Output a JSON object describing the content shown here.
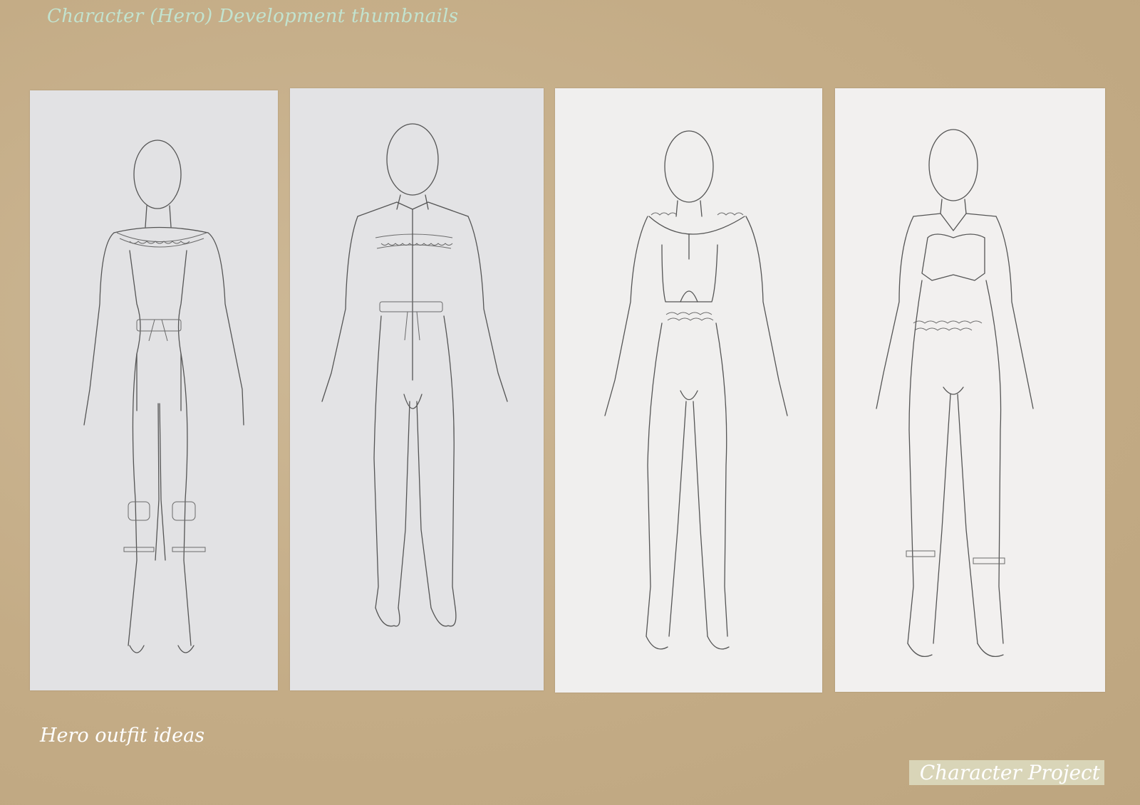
{
  "page": {
    "title": "Character (Hero) Development thumbnails",
    "caption": "Hero outfit ideas",
    "project_label": "Character Project"
  },
  "colors": {
    "background": "#c6ae88",
    "title_text": "#c2e3cf",
    "caption_text": "#ffffff",
    "project_tag_bg": "#d9d5b8"
  },
  "thumbnails": [
    {
      "id": "outfit-1"
    },
    {
      "id": "outfit-2"
    },
    {
      "id": "outfit-3"
    },
    {
      "id": "outfit-4"
    }
  ]
}
